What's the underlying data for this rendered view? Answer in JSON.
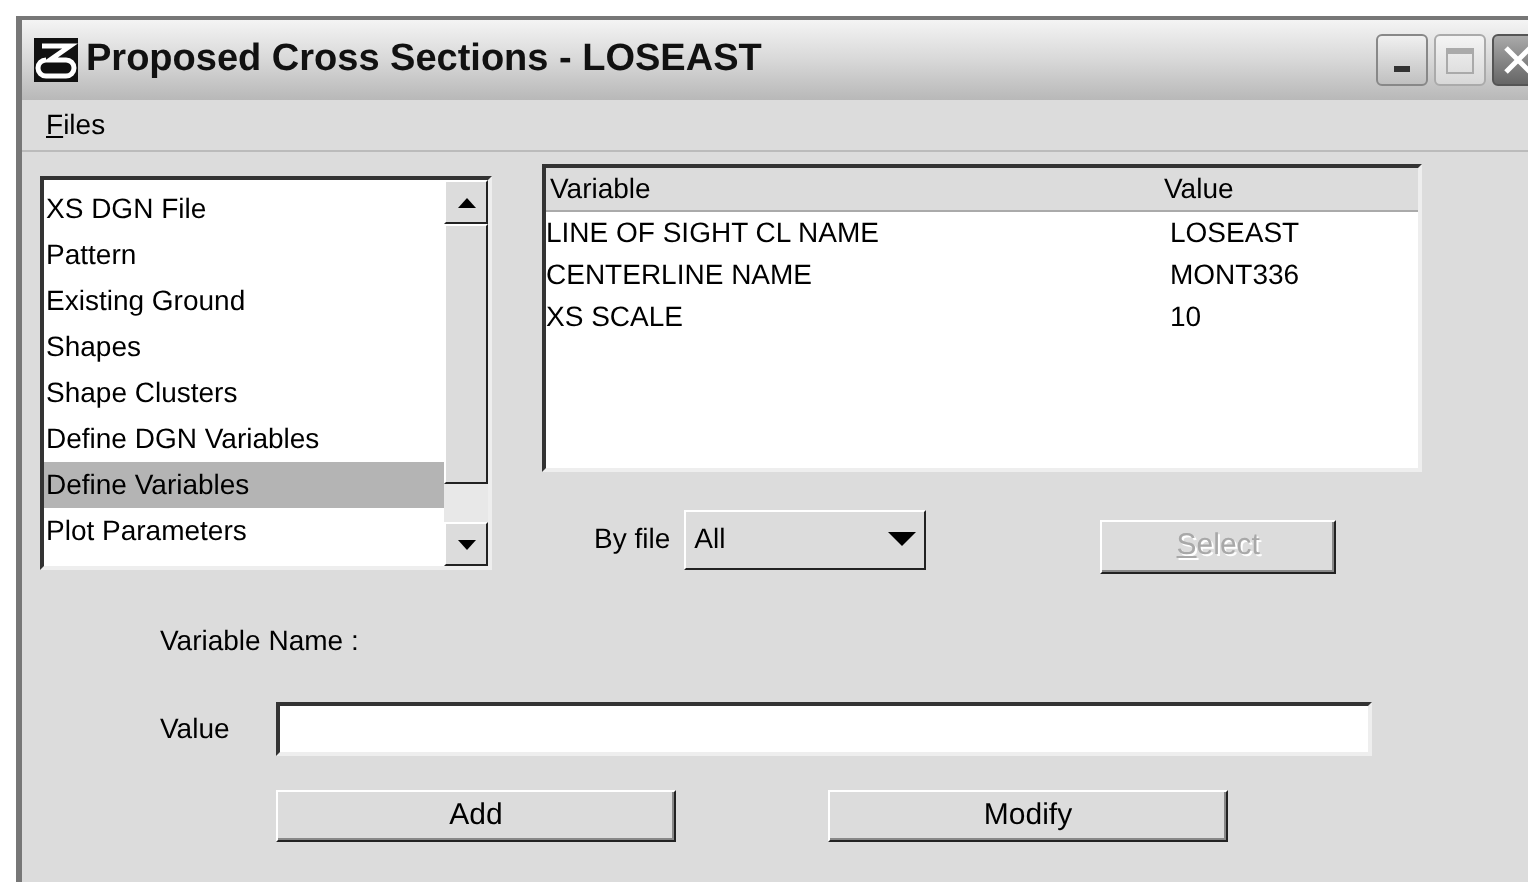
{
  "window": {
    "title": "Proposed Cross Sections - LOSEAST"
  },
  "menu": [
    {
      "label": "Files",
      "mnemonic_underlined": true
    }
  ],
  "categories": [
    {
      "label": "XS DGN File",
      "selected": false
    },
    {
      "label": "Pattern",
      "selected": false
    },
    {
      "label": "Existing Ground",
      "selected": false
    },
    {
      "label": "Shapes",
      "selected": false
    },
    {
      "label": "Shape Clusters",
      "selected": false
    },
    {
      "label": "Define DGN Variables",
      "selected": false
    },
    {
      "label": "Define Variables",
      "selected": true
    },
    {
      "label": "Plot Parameters",
      "selected": false
    }
  ],
  "table": {
    "columns": [
      "Variable",
      "Value"
    ],
    "rows": [
      [
        "LINE OF SIGHT CL NAME",
        "LOSEAST"
      ],
      [
        "CENTERLINE NAME",
        "MONT336"
      ],
      [
        "XS SCALE",
        "10"
      ]
    ]
  },
  "filter": {
    "label": "By file",
    "value": "All"
  },
  "select_button": {
    "label": "Select",
    "mnemonic_underlined": true,
    "disabled": true
  },
  "variable_name_label": "Variable Name :",
  "value_field": {
    "label": "Value"
  },
  "buttons": [
    "Add",
    "Modify"
  ]
}
